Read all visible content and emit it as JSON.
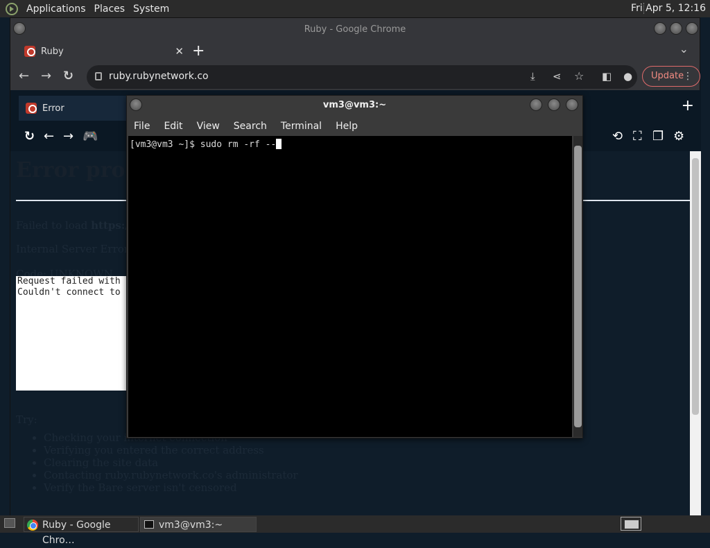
{
  "top_panel": {
    "menus": [
      "Applications",
      "Places",
      "System"
    ],
    "clock": "Fri Apr 5, 12:16"
  },
  "chrome": {
    "window_title": "Ruby - Google Chrome",
    "tab_title": "Ruby",
    "url": "ruby.rubynetwork.co",
    "update_label": "Update"
  },
  "ruby_app": {
    "tab_title": "Error"
  },
  "error_page": {
    "heading": "Error proce",
    "failed_prefix": "Failed to load ",
    "failed_bold": "https://",
    "status": "Internal Server Error",
    "code": "Code: UNKNOWN",
    "pre_lines": [
      "Request failed with",
      "Couldn't connect to"
    ],
    "try_label": "Try:",
    "suggestions": [
      "Checking your internet connection",
      "Verifying you entered the correct address",
      "Clearing the site data",
      "Contacting ruby.rubynetwork.co's administrator",
      "Verify the Bare server isn't censored"
    ]
  },
  "terminal": {
    "title": "vm3@vm3:~",
    "menus": [
      "File",
      "Edit",
      "View",
      "Search",
      "Terminal",
      "Help"
    ],
    "prompt_line": "[vm3@vm3 ~]$ sudo rm -rf --"
  },
  "taskbar": {
    "tasks": [
      "Ruby - Google Chro…",
      "vm3@vm3:~"
    ]
  },
  "colors": {
    "panel_bg": "#2b2b2b",
    "chrome_frame": "#35363a",
    "page_bg": "#0f1d2a",
    "update_accent": "#f28b82",
    "terminal_bg": "#000000"
  }
}
